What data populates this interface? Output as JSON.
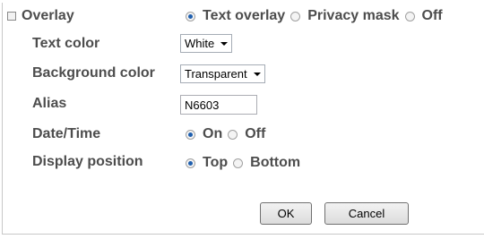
{
  "overlay": {
    "label": "Overlay",
    "options": [
      "Text overlay",
      "Privacy mask",
      "Off"
    ],
    "selected": "Text overlay"
  },
  "text_color": {
    "label": "Text color",
    "value": "White"
  },
  "background_color": {
    "label": "Background color",
    "value": "Transparent"
  },
  "alias": {
    "label": "Alias",
    "value": "N6603"
  },
  "datetime": {
    "label": "Date/Time",
    "options": [
      "On",
      "Off"
    ],
    "selected": "On"
  },
  "display_position": {
    "label": "Display position",
    "options": [
      "Top",
      "Bottom"
    ],
    "selected": "Top"
  },
  "buttons": {
    "ok": "OK",
    "cancel": "Cancel"
  },
  "colors": {
    "text": "#4d4d4d",
    "radio_selected": "#1f5fae",
    "border": "#c8c8c8"
  }
}
